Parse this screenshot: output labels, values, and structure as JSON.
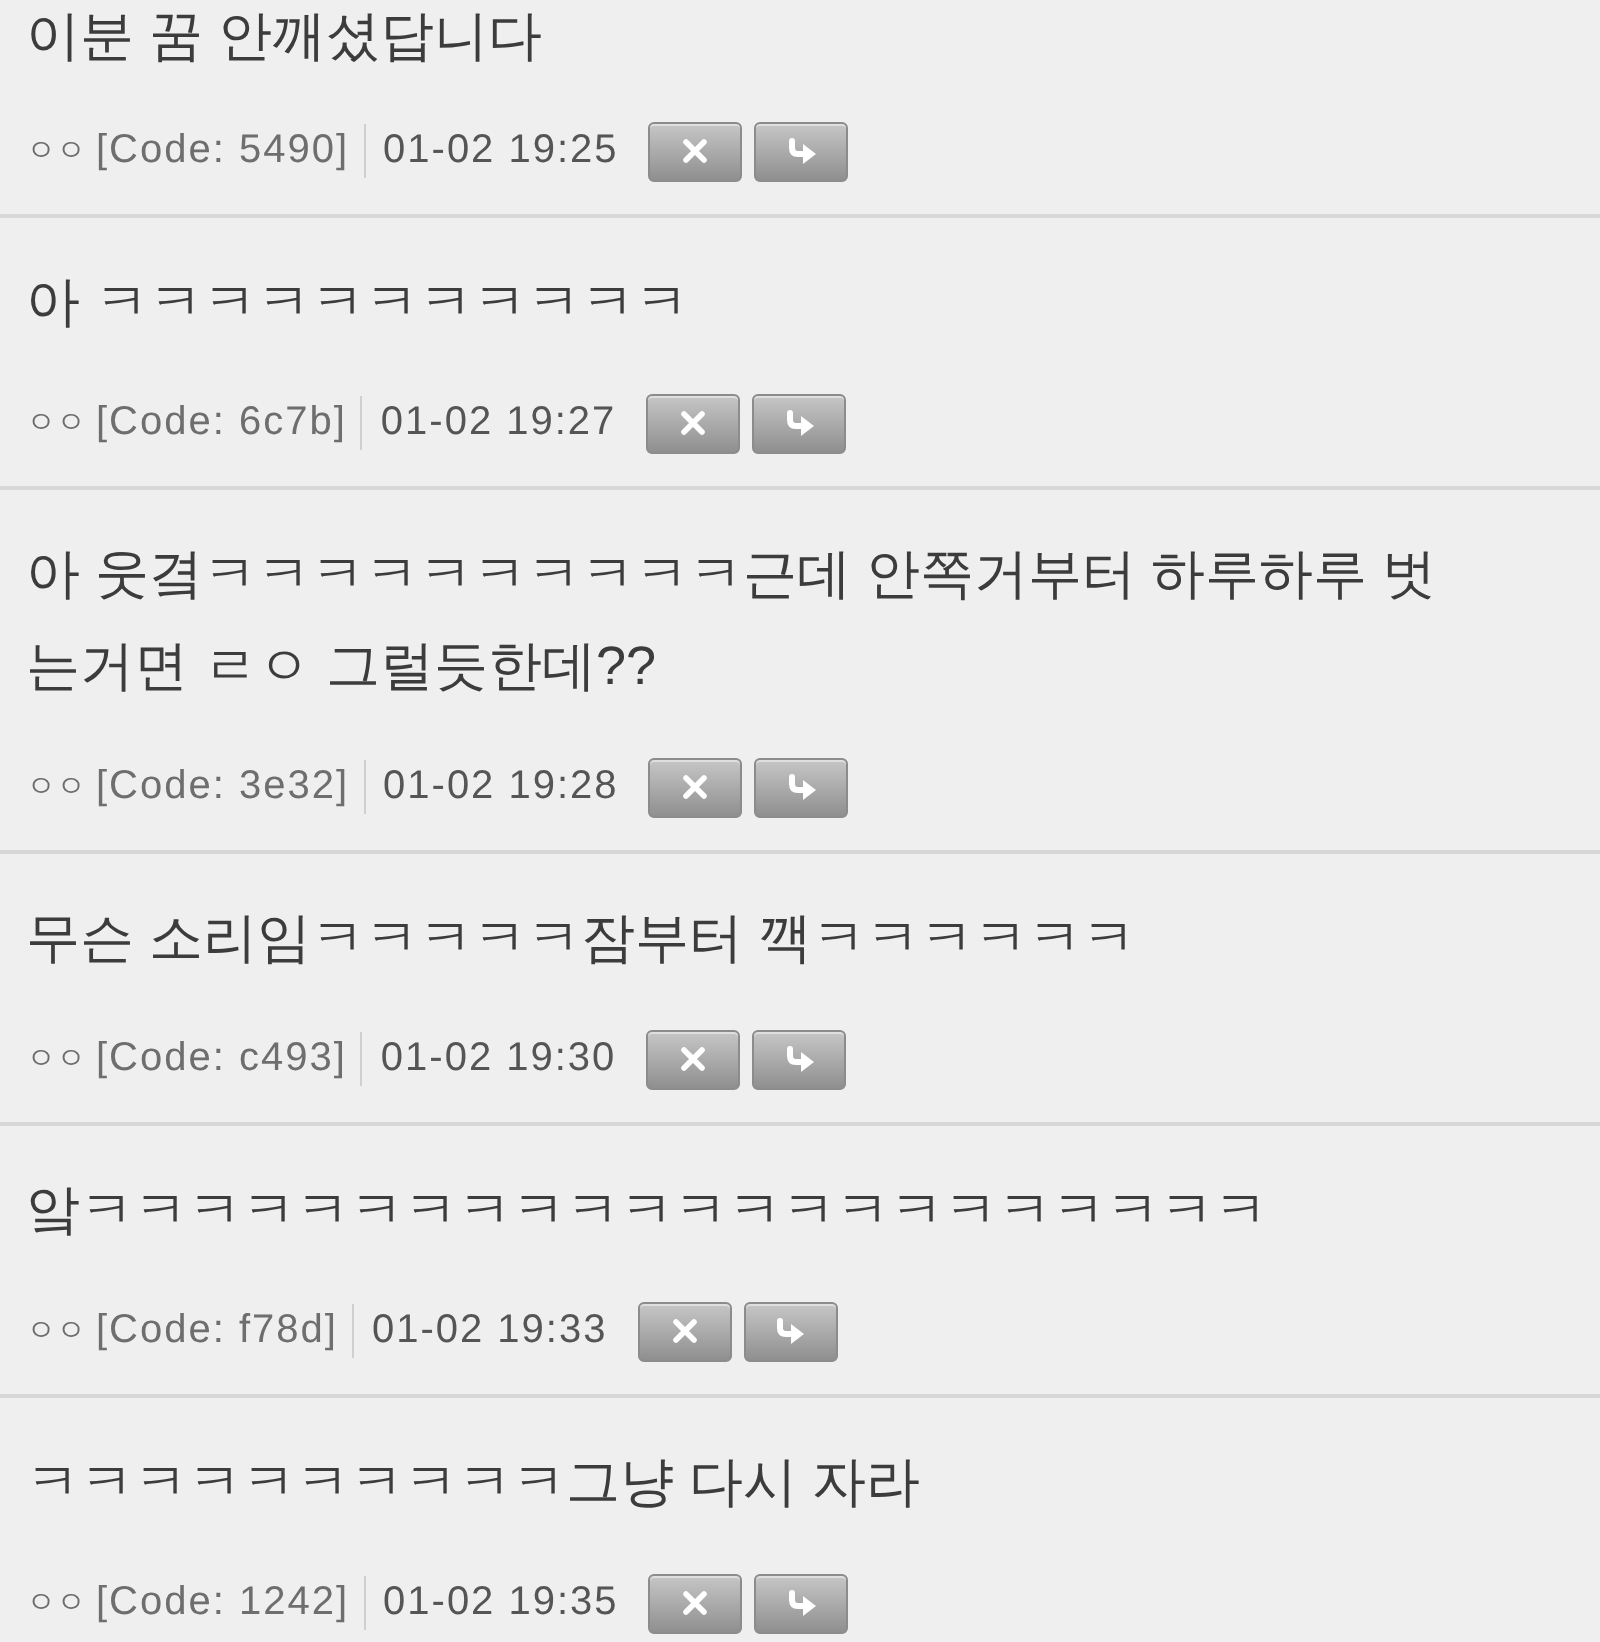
{
  "comments": [
    {
      "text": "이분 꿈 안깨셨답니다",
      "author": "ㅇㅇ",
      "code": "[Code: 5490]",
      "time": "01-02 19:25"
    },
    {
      "text": "아 ㅋㅋㅋㅋㅋㅋㅋㅋㅋㅋㅋ",
      "author": "ㅇㅇ",
      "code": "[Code: 6c7b]",
      "time": "01-02 19:27"
    },
    {
      "text": "아 웃곀ㅋㅋㅋㅋㅋㅋㅋㅋㅋㅋ근데 안쪽거부터 하루하루 벗는거면 ㄹㅇ 그럴듯한데??",
      "author": "ㅇㅇ",
      "code": "[Code: 3e32]",
      "time": "01-02 19:28"
    },
    {
      "text": "무슨 소리임ㅋㅋㅋㅋㅋ잠부터 깩ㅋㅋㅋㅋㅋㅋ",
      "author": "ㅇㅇ",
      "code": "[Code: c493]",
      "time": "01-02 19:30"
    },
    {
      "text": "앜ㅋㅋㅋㅋㅋㅋㅋㅋㅋㅋㅋㅋㅋㅋㅋㅋㅋㅋㅋㅋㅋㅋ",
      "author": "ㅇㅇ",
      "code": "[Code: f78d]",
      "time": "01-02 19:33"
    },
    {
      "text": "ㅋㅋㅋㅋㅋㅋㅋㅋㅋㅋ그냥 다시 자라",
      "author": "ㅇㅇ",
      "code": "[Code: 1242]",
      "time": "01-02 19:35"
    }
  ]
}
